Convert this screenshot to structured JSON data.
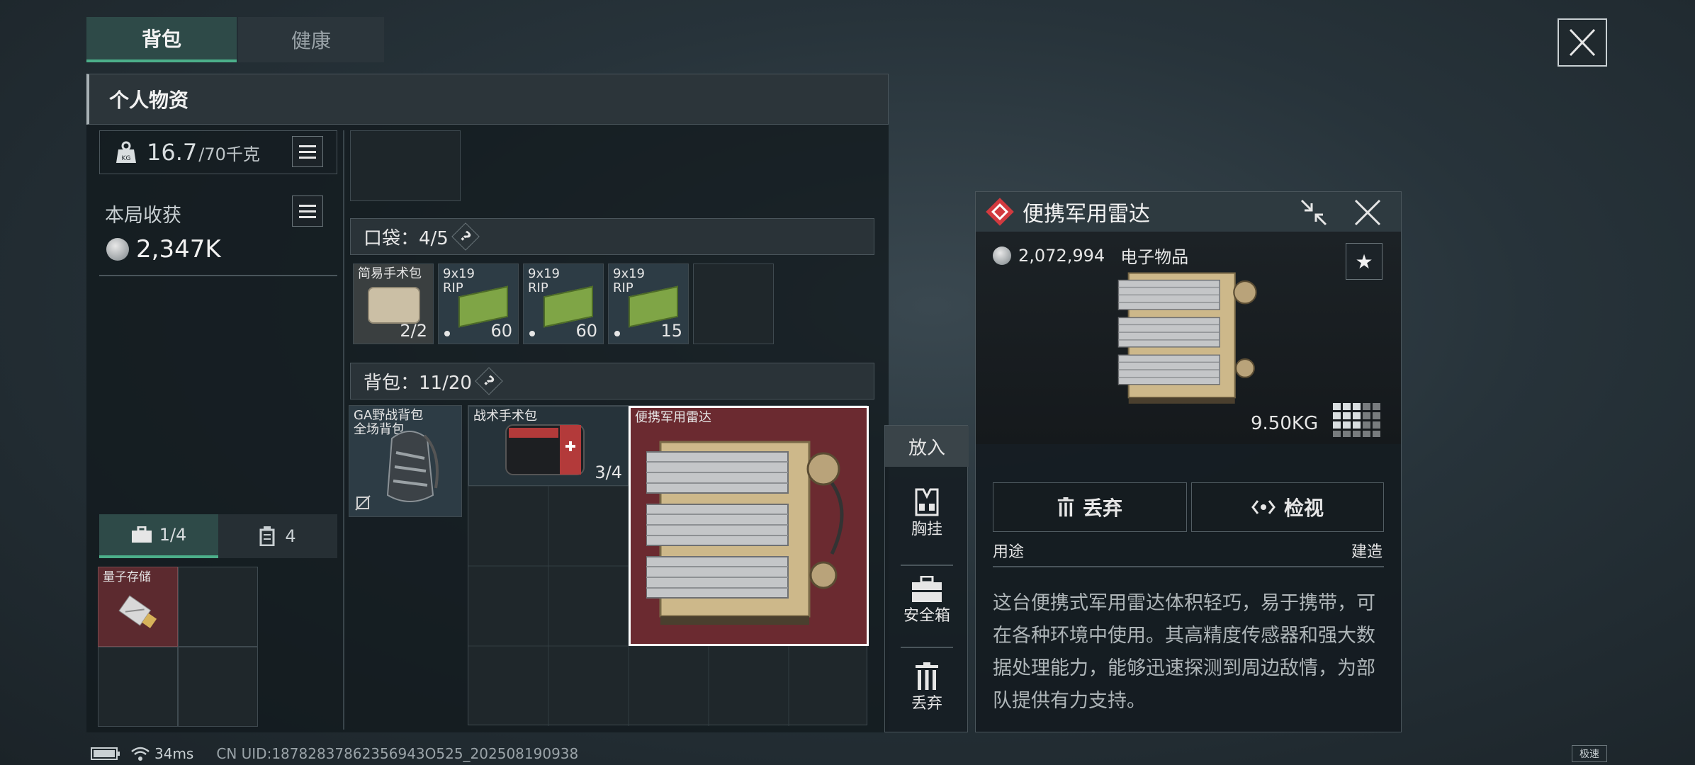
{
  "tabs": [
    {
      "label": "背包",
      "active": true
    },
    {
      "label": "健康",
      "active": false
    }
  ],
  "section_title": "个人物资",
  "weight": {
    "current": "16.7",
    "max": "/70千克",
    "icon": "kg-weight-icon"
  },
  "harvest": {
    "label": "本局收获",
    "value": "2,347K"
  },
  "storage_tabs": [
    {
      "label": "1/4",
      "icon": "briefcase-icon"
    },
    {
      "label": "4",
      "icon": "canister-icon"
    }
  ],
  "storage_items": [
    {
      "label": "量子存储"
    }
  ],
  "pockets": {
    "label": "口袋：4/5",
    "help": "?",
    "items": [
      {
        "label": "简易手术包",
        "count": "2/2"
      },
      {
        "label": "9x19\nRIP",
        "count": "60"
      },
      {
        "label": "9x19\nRIP",
        "count": "60"
      },
      {
        "label": "9x19\nRIP",
        "count": "15"
      }
    ]
  },
  "backpack": {
    "label": "背包：11/20",
    "help": "?",
    "items": [
      {
        "label": "GA野战背包\n全场背包"
      },
      {
        "label": "战术手术包",
        "count": "3/4"
      },
      {
        "label": "便携军用雷达"
      }
    ]
  },
  "side_actions": {
    "put_in": "放入",
    "items": [
      {
        "label": "胸挂",
        "icon": "vest-icon"
      },
      {
        "label": "安全箱",
        "icon": "safe-box-icon"
      },
      {
        "label": "丢弃",
        "icon": "trash-icon"
      }
    ]
  },
  "detail": {
    "title": "便携军用雷达",
    "price": "2,072,994",
    "category": "电子物品",
    "weight": "9.50KG",
    "discard_label": "丢弃",
    "inspect_label": "检视",
    "usage_label": "用途",
    "craft_label": "建造",
    "description": "这台便携式军用雷达体积轻巧，易于携带，可在各种环境中使用。其高精度传感器和强大数据处理能力，能够迅速探测到周边敌情，为部队提供有力支持。"
  },
  "status_bar": {
    "ping": "34ms",
    "uid": "CN UID:18782837862356943O525_202508190938",
    "mode": "极速"
  },
  "colors": {
    "accent_green": "#4caf8a",
    "item_highlight": "#6b2a30",
    "diamond_red": "#d23a3f"
  }
}
